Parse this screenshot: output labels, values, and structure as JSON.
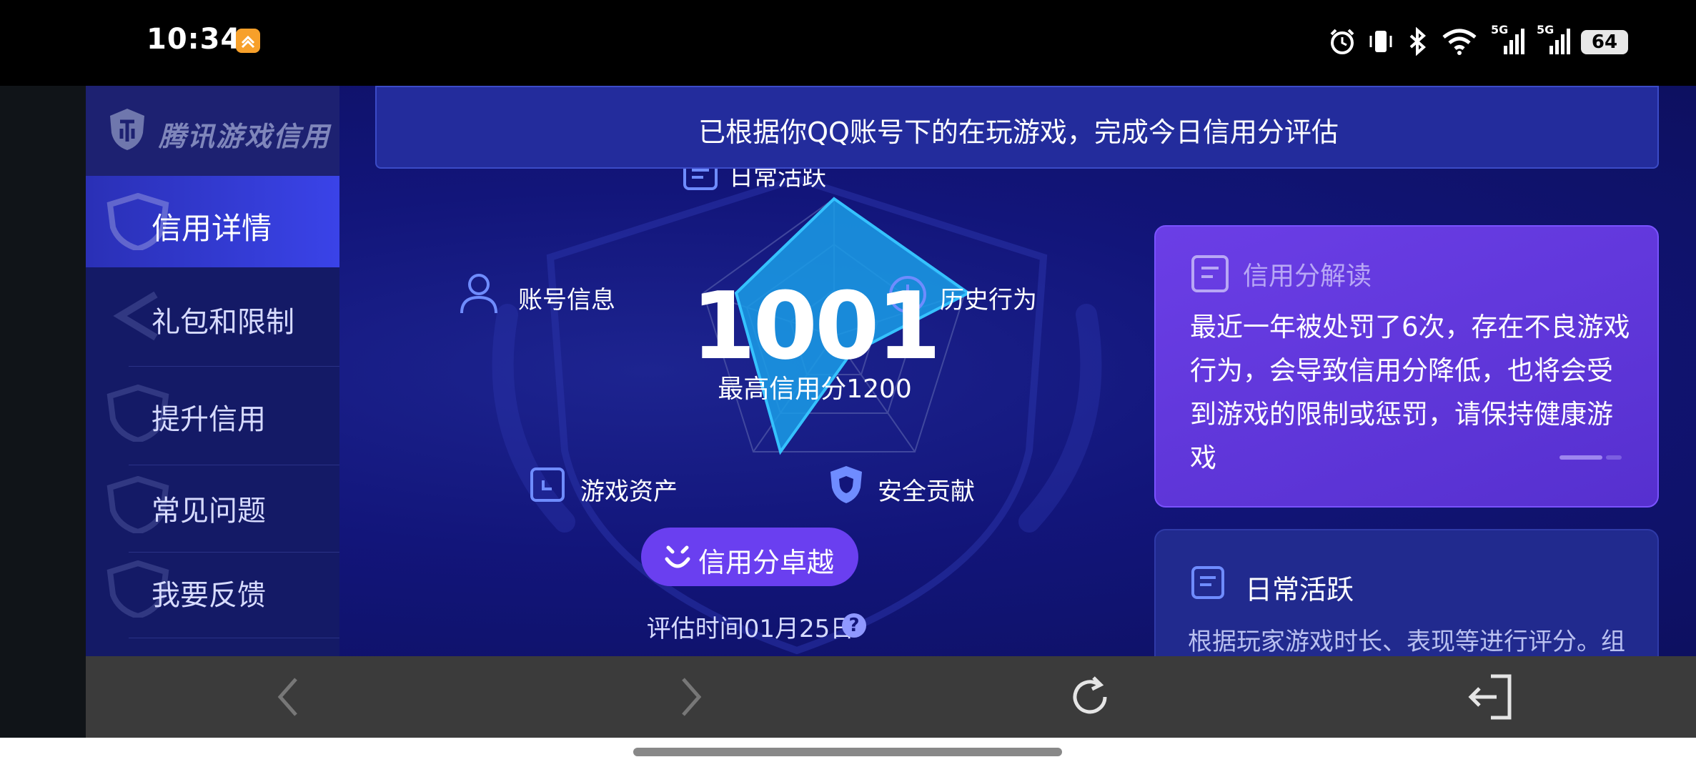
{
  "status": {
    "time": "10:34",
    "battery": "64",
    "net1": "5G",
    "net2": "5G"
  },
  "brand": {
    "name": "腾讯游戏信用"
  },
  "sidebar": {
    "items": [
      {
        "label": "信用详情",
        "active": true
      },
      {
        "label": "礼包和限制"
      },
      {
        "label": "提升信用"
      },
      {
        "label": "常见问题"
      },
      {
        "label": "我要反馈"
      }
    ]
  },
  "banner": {
    "text": "已根据你QQ账号下的在玩游戏，完成今日信用分评估"
  },
  "radar": {
    "labels": {
      "daily": "日常活跃",
      "history": "历史行为",
      "safety": "安全贡献",
      "assets": "游戏资产",
      "account": "账号信息"
    },
    "score": "1001",
    "max_score": "最高信用分1200",
    "grade": "信用分卓越",
    "eval_time": "评估时间01月25日",
    "help": "?"
  },
  "card_interpret": {
    "title": "信用分解读",
    "body": "最近一年被处罚了6次，存在不良游戏行为，会导致信用分降低，也将会受到游戏的限制或惩罚，请保持健康游戏"
  },
  "card_daily": {
    "title": "日常活跃",
    "body": "根据玩家游戏时长、表现等进行评分。组"
  },
  "colors": {
    "accent_purple": "#6a3ff0",
    "app_bg": "#10136b",
    "radar_fill": "#1a9ee8"
  }
}
